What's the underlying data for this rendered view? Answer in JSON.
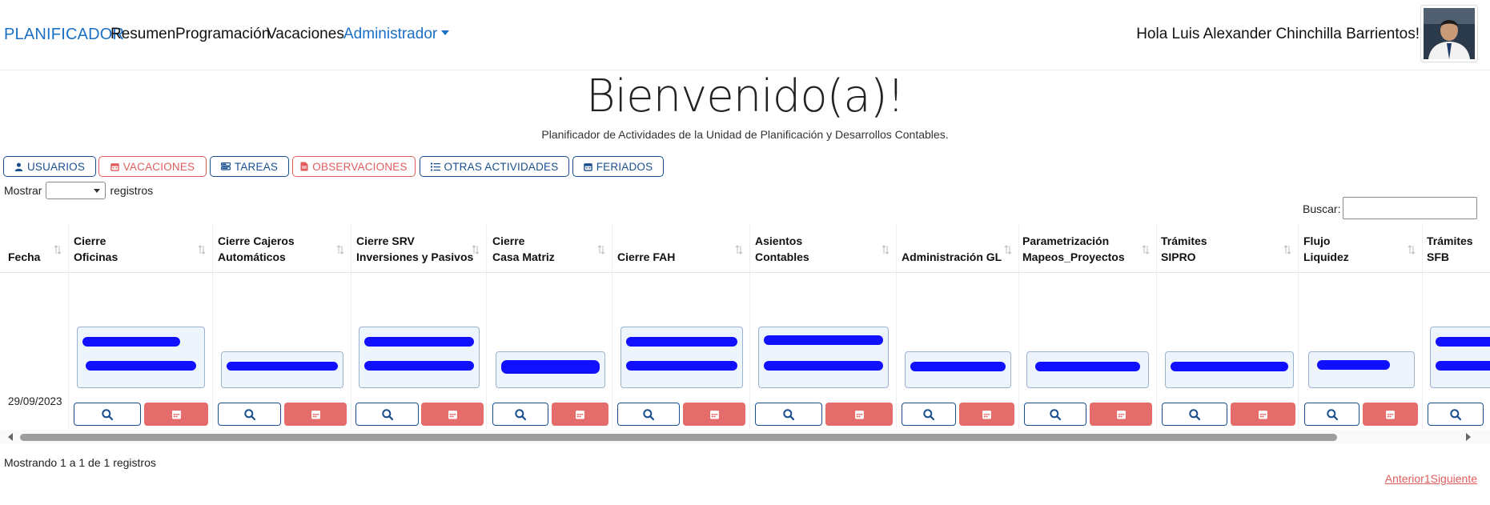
{
  "navbar": {
    "brand": "PLANIFICADOR",
    "items": [
      "Resumen",
      "Programación",
      "Vacaciones"
    ],
    "admin": "Administrador",
    "greeting": "Hola Luis Alexander Chinchilla Barrientos!"
  },
  "hero": {
    "title": "Bienvenido(a)!",
    "subtitle": "Planificador de Actividades de la Unidad de Planificación y Desarrollos Contables."
  },
  "toolbar": {
    "buttons": [
      {
        "label": "USUARIOS",
        "icon": "user-icon",
        "color": "#1a4f8f"
      },
      {
        "label": "VACACIONES",
        "icon": "calendar-icon",
        "color": "#e05c5c"
      },
      {
        "label": "TAREAS",
        "icon": "tasks-icon",
        "color": "#1a4f8f"
      },
      {
        "label": "OBSERVACIONES",
        "icon": "file-icon",
        "color": "#e05c5c"
      },
      {
        "label": "OTRAS ACTIVIDADES",
        "icon": "list-icon",
        "color": "#1a4f8f"
      },
      {
        "label": "FERIADOS",
        "icon": "calendar-icon",
        "color": "#1a4f8f"
      }
    ]
  },
  "table_controls": {
    "show_prefix": "Mostrar",
    "show_suffix": "registros",
    "search_label": "Buscar:"
  },
  "table": {
    "columns": [
      "Fecha",
      "Cierre\nOficinas",
      "Cierre Cajeros\nAutomáticos",
      "Cierre SRV\nInversiones y Pasivos",
      "Cierre\nCasa Matriz",
      "Cierre FAH",
      "Asientos\nContables",
      "Administración GL",
      "Parametrización\nMapeos_Proyectos",
      "Trámites\nSIPRO",
      "Flujo\nLiquidez",
      "Trámites\nSFB"
    ],
    "rows": [
      {
        "date": "29/09/2023"
      }
    ]
  },
  "footer": {
    "info": "Mostrando 1 a 1 de 1 registros",
    "prev": "Anterior",
    "page": "1",
    "next": "Siguiente"
  },
  "colors": {
    "primary": "#1a4f8f",
    "brand": "#1a6fc6",
    "danger": "#e46c6a",
    "redacted": "#1010ff"
  }
}
